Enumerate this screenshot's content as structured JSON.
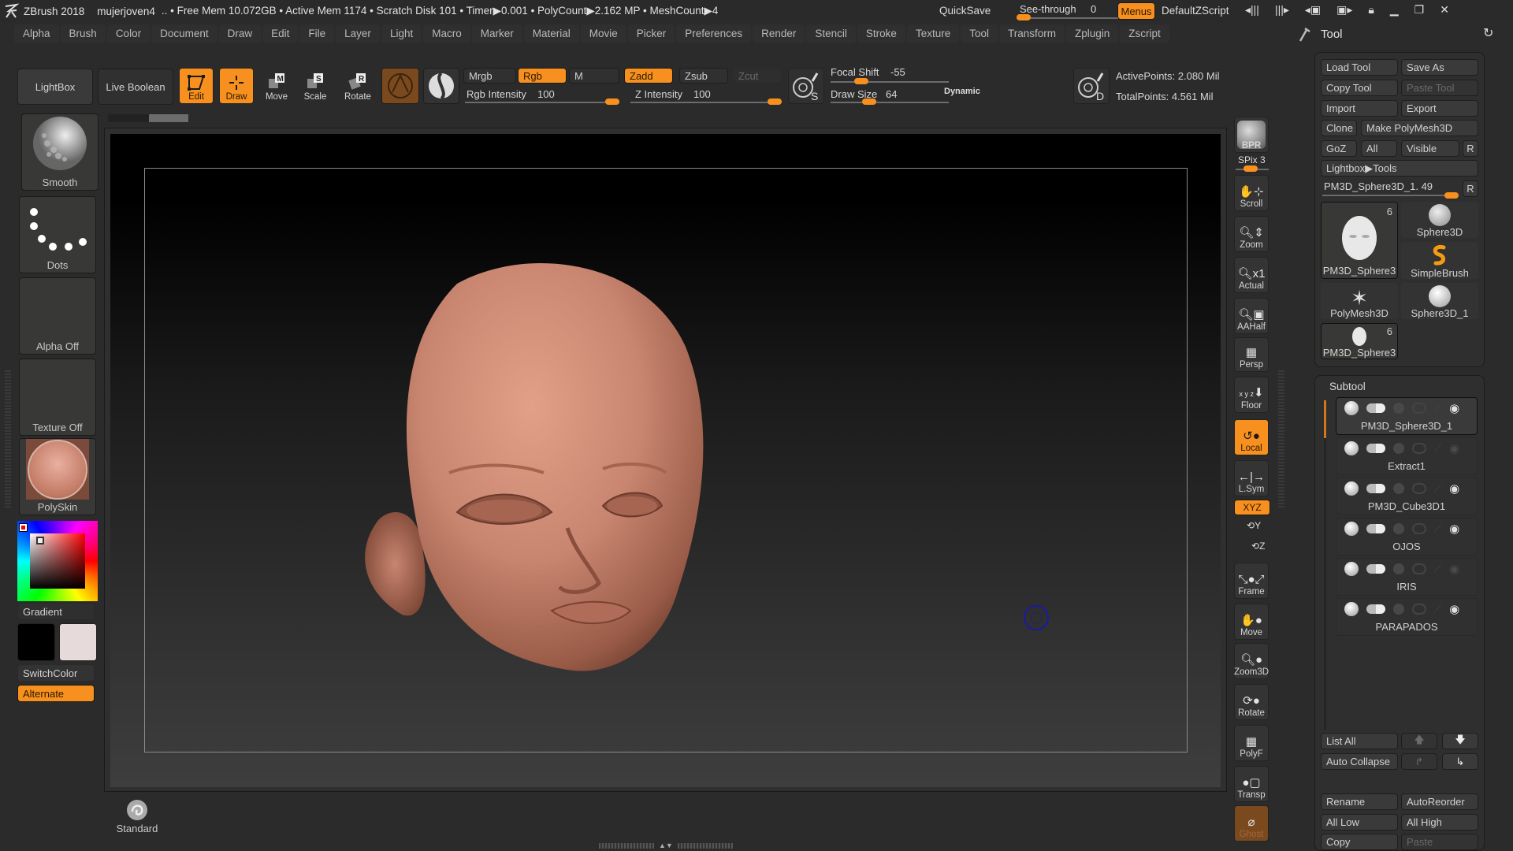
{
  "titlebar": {
    "app": "ZBrush 2018",
    "document": "mujerjoven4",
    "stats": ".. • Free Mem 10.072GB • Active Mem 1174 • Scratch Disk 101 •  Timer▶0.001 • PolyCount▶2.162 MP  • MeshCount▶4",
    "quicksave": "QuickSave",
    "see_through_label": "See-through",
    "see_through_value": "0",
    "see_through_fraction": 0.0,
    "menus": "Menus",
    "zscript": "DefaultZScript"
  },
  "menubar": [
    "Alpha",
    "Brush",
    "Color",
    "Document",
    "Draw",
    "Edit",
    "File",
    "Layer",
    "Light",
    "Macro",
    "Marker",
    "Material",
    "Movie",
    "Picker",
    "Preferences",
    "Render",
    "Stencil",
    "Stroke",
    "Texture",
    "Tool",
    "Transform",
    "Zplugin",
    "Zscript"
  ],
  "toolbar": {
    "lightbox": "LightBox",
    "live_boolean": "Live Boolean",
    "edit": "Edit",
    "draw": "Draw",
    "move": "Move",
    "scale": "Scale",
    "rotate": "Rotate",
    "mrgb": "Mrgb",
    "rgb": "Rgb",
    "m": "M",
    "zadd": "Zadd",
    "zsub": "Zsub",
    "zcut": "Zcut",
    "rgb_intensity_label": "Rgb Intensity",
    "rgb_intensity": "100",
    "z_intensity_label": "Z Intensity",
    "z_intensity": "100",
    "focal_shift_label": "Focal Shift",
    "focal_shift": "-55",
    "draw_size_label": "Draw Size",
    "draw_size": "64",
    "dynamic": "Dynamic",
    "active_points": "ActivePoints: 2.080 Mil",
    "total_points": "TotalPoints: 4.561 Mil"
  },
  "left_shelf": {
    "brush": "Smooth",
    "stroke": "Dots",
    "alpha": "Alpha Off",
    "texture": "Texture Off",
    "material": "PolySkin",
    "gradient": "Gradient",
    "main_color": "#000000",
    "secondary_color": "#e6dada",
    "switch_color": "SwitchColor",
    "alternate": "Alternate",
    "standard": "Standard"
  },
  "right_shelf": [
    "BPR",
    "SPix 3",
    "Scroll",
    "Zoom",
    "Actual",
    "AAHalf",
    "Persp",
    "Floor",
    "Local",
    "L.Sym",
    "XYZ",
    "Y",
    "Z",
    "Frame",
    "Move",
    "Zoom3D",
    "Rotate",
    "PolyF",
    "Transp",
    "Ghost"
  ],
  "tool_panel": {
    "title": "Tool",
    "buttons": {
      "load_tool": "Load Tool",
      "save_as": "Save As",
      "copy_tool": "Copy Tool",
      "paste_tool": "Paste Tool",
      "import": "Import",
      "export": "Export",
      "clone": "Clone",
      "make_polymesh": "Make PolyMesh3D",
      "goz": "GoZ",
      "all": "All",
      "visible": "Visible",
      "r": "R",
      "lightbox_tools": "Lightbox▶Tools",
      "current_tool": "PM3D_Sphere3D_1. 49"
    },
    "tools": [
      {
        "name": "PM3D_Sphere3",
        "count": "6"
      },
      {
        "name": "Sphere3D"
      },
      {
        "name": "SimpleBrush"
      },
      {
        "name": "PolyMesh3D"
      },
      {
        "name": "Sphere3D_1"
      },
      {
        "name": "PM3D_Sphere3",
        "count": "6"
      }
    ]
  },
  "subtool": {
    "title": "Subtool",
    "items": [
      {
        "name": "PM3D_Sphere3D_1"
      },
      {
        "name": "Extract1"
      },
      {
        "name": "PM3D_Cube3D1"
      },
      {
        "name": "OJOS"
      },
      {
        "name": "IRIS"
      },
      {
        "name": "PARAPADOS"
      }
    ],
    "list_all": "List All",
    "auto_collapse": "Auto Collapse",
    "rename": "Rename",
    "auto_reorder": "AutoReorder",
    "all_low": "All Low",
    "all_high": "All High",
    "copy": "Copy",
    "paste": "Paste"
  },
  "colors": {
    "accent": "#f7901e",
    "skin": "#c9856f"
  }
}
